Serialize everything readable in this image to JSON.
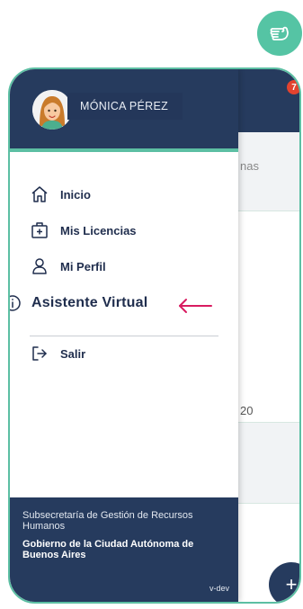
{
  "user": {
    "name": "MÓNICA PÉREZ"
  },
  "menu": {
    "items": [
      {
        "label": "Inicio",
        "icon": "home-icon"
      },
      {
        "label": "Mis Licencias",
        "icon": "medical-case-icon"
      },
      {
        "label": "Mi Perfil",
        "icon": "user-icon"
      },
      {
        "label": "Asistente Virtual",
        "icon": "info-icon"
      }
    ],
    "logout": {
      "label": "Salir",
      "icon": "logout-icon"
    }
  },
  "footer": {
    "subsecretaria": "Subsecretaría de Gestión de Recursos Humanos",
    "gobierno": "Gobierno de la Ciudad Autónoma de Buenos Aires",
    "version": "v-dev"
  },
  "background": {
    "badge": "7",
    "partial_text_1": "nas",
    "partial_text_2": "20",
    "fab_label": "+"
  },
  "colors": {
    "navy": "#263b5e",
    "accent_green": "#5cbfa3",
    "arrow": "#d81b60"
  }
}
